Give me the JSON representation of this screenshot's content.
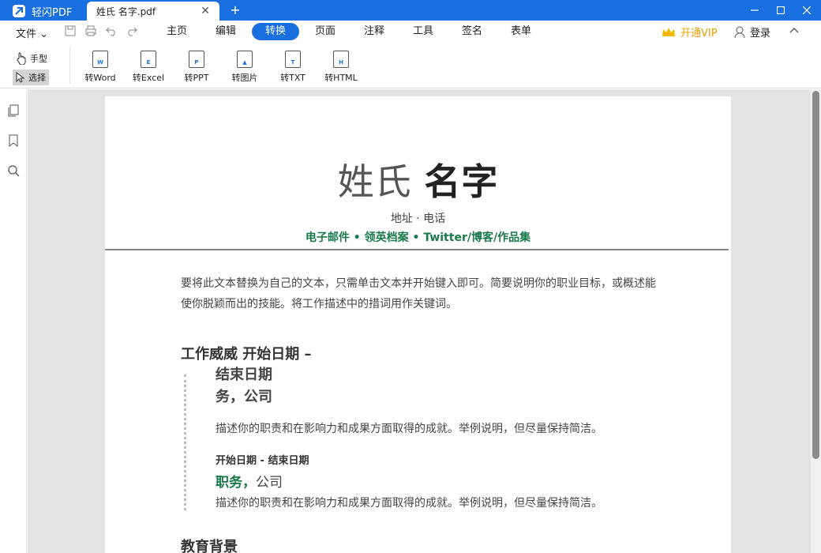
{
  "app": {
    "name": "轻闪PDF",
    "doc_tab": "姓氏 名字.pdf",
    "new_tab": "+",
    "close_tab": "✕"
  },
  "menu": {
    "file": "文件 ⌄",
    "tabs": [
      "主页",
      "编辑",
      "转换",
      "页面",
      "注释",
      "工具",
      "签名",
      "表单"
    ],
    "active_tab": "转换",
    "vip": "开通VIP",
    "login": "登录"
  },
  "toolbar": {
    "hand": "手型",
    "select": "选择",
    "convert": [
      {
        "label": "转Word",
        "letter": "W"
      },
      {
        "label": "转Excel",
        "letter": "E"
      },
      {
        "label": "转PPT",
        "letter": "P"
      },
      {
        "label": "转图片",
        "letter": "▲"
      },
      {
        "label": "转TXT",
        "letter": "T"
      },
      {
        "label": "转HTML",
        "letter": "H"
      }
    ]
  },
  "document": {
    "surname": "姓氏",
    "given_name": "名字",
    "contact_line1": "地址 · 电话",
    "contact_line2": "电子邮件 • 领英档案 • Twitter/博客/作品集",
    "summary": "要将此文本替换为自己的文本，只需单击文本并开始键入即可。简要说明你的职业目标，或概述能使你脱颖而出的技能。将工作描述中的措词用作关键词。",
    "work_heading": "工作威威 开始日期 –",
    "job1_line1": "结束日期",
    "job1_line2": "务，公司",
    "job1_desc": "描述你的职责和在影响力和成果方面取得的成就。举例说明，但尽量保持简洁。",
    "job2_dates": "开始日期 - 结束日期",
    "job2_title": "职务，",
    "job2_company": "公司",
    "job2_desc": "描述你的职责和在影响力和成果方面取得的成就。举例说明，但尽量保持简洁。",
    "education_heading": "教育背景"
  },
  "colors": {
    "brand": "#1a6fe0",
    "accent_green": "#1b7a4a",
    "vip": "#e8a000"
  }
}
